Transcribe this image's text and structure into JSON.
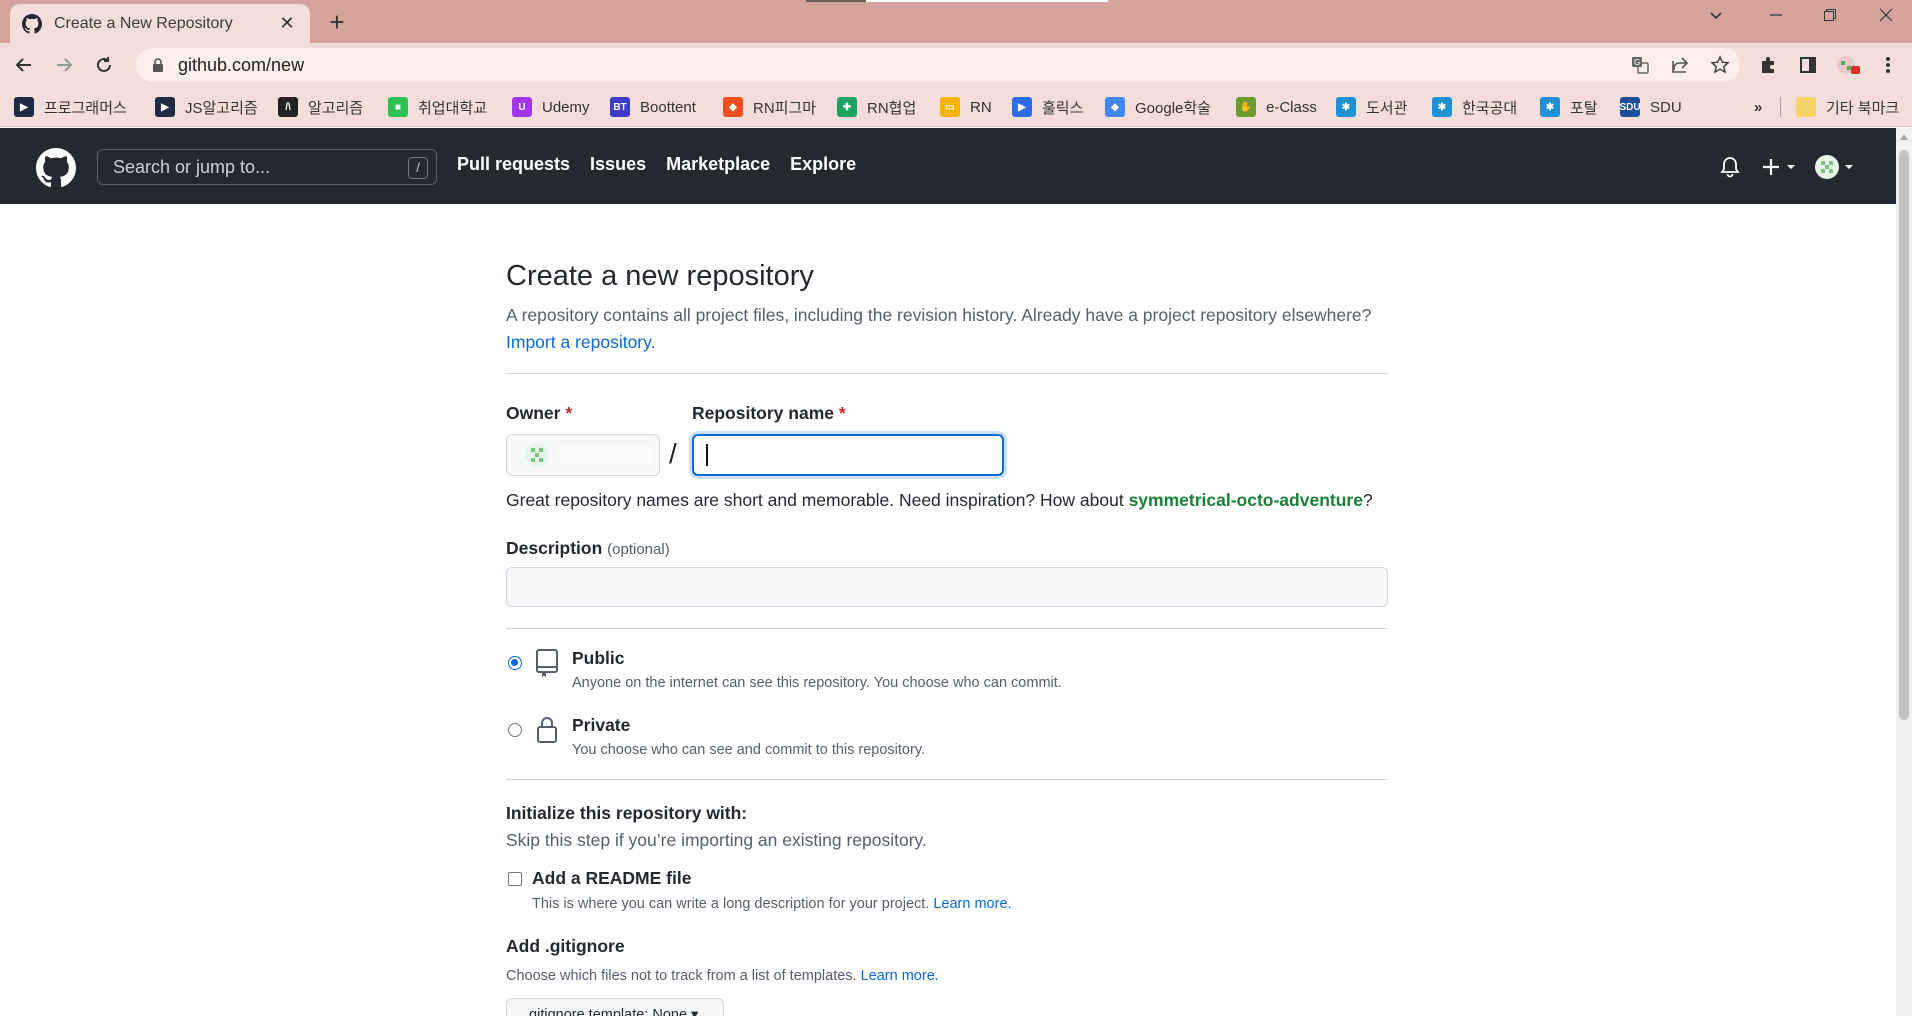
{
  "browser": {
    "tab_title": "Create a New Repository",
    "url": "github.com/new",
    "bookmarks": [
      {
        "label": "프로그래머스",
        "color": "#1f2a44",
        "glyph": "▶"
      },
      {
        "label": "JS알고리즘",
        "color": "#1f2a44",
        "glyph": "▶"
      },
      {
        "label": "알고리즘",
        "color": "#222222",
        "glyph": "/\\"
      },
      {
        "label": "취업대학교",
        "color": "#2ec254",
        "glyph": "■"
      },
      {
        "label": "Udemy",
        "color": "#a435f0",
        "glyph": "U"
      },
      {
        "label": "Boottent",
        "color": "#3c3cc8",
        "glyph": "BT"
      },
      {
        "label": "RN피그마",
        "color": "#f24e1e",
        "glyph": "◆"
      },
      {
        "label": "RN협업",
        "color": "#1aa260",
        "glyph": "✚"
      },
      {
        "label": "RN",
        "color": "#f4b400",
        "glyph": "▭"
      },
      {
        "label": "훌릭스",
        "color": "#2e6bf0",
        "glyph": "▶"
      },
      {
        "label": "Google학술",
        "color": "#4285f4",
        "glyph": "◆"
      },
      {
        "label": "e-Class",
        "color": "#6f9a2e",
        "glyph": "✋"
      },
      {
        "label": "도서관",
        "color": "#1e90d6",
        "glyph": "✱"
      },
      {
        "label": "한국공대",
        "color": "#1e90d6",
        "glyph": "✱"
      },
      {
        "label": "포탈",
        "color": "#1e90d6",
        "glyph": "✱"
      },
      {
        "label": "SDU",
        "color": "#1b4f9c",
        "glyph": "SDU"
      }
    ],
    "overflow": "»",
    "other_bookmarks": "기타 북마크"
  },
  "header": {
    "search_placeholder": "Search or jump to...",
    "search_shortcut": "/",
    "nav": [
      "Pull requests",
      "Issues",
      "Marketplace",
      "Explore"
    ]
  },
  "page": {
    "title": "Create a new repository",
    "subtitle": "A repository contains all project files, including the revision history. Already have a project repository elsewhere?",
    "import_link": "Import a repository.",
    "owner_label": "Owner",
    "required_mark": "*",
    "repo_name_label": "Repository name",
    "separator": "/",
    "hint_prefix": "Great repository names are short and memorable. Need inspiration? How about",
    "suggestion": "symmetrical-octo-adventure",
    "hint_suffix": "?",
    "description_label": "Description",
    "description_optional": "(optional)",
    "visibility": [
      {
        "title": "Public",
        "desc": "Anyone on the internet can see this repository. You choose who can commit.",
        "checked": true
      },
      {
        "title": "Private",
        "desc": "You choose who can see and commit to this repository.",
        "checked": false
      }
    ],
    "init_title": "Initialize this repository with:",
    "init_sub": "Skip this step if you’re importing an existing repository.",
    "readme_title": "Add a README file",
    "readme_desc": "This is where you can write a long description for your project.",
    "learn_more": "Learn more.",
    "gitignore_title": "Add .gitignore",
    "gitignore_desc": "Choose which files not to track from a list of templates.",
    "gitignore_button": ".gitignore template: None ▾"
  },
  "colors": {
    "header_bg": "#24292f",
    "link": "#0969da",
    "suggestion": "#1a7f37",
    "required": "#cf222e",
    "tabstrip": "#d3a39c"
  }
}
